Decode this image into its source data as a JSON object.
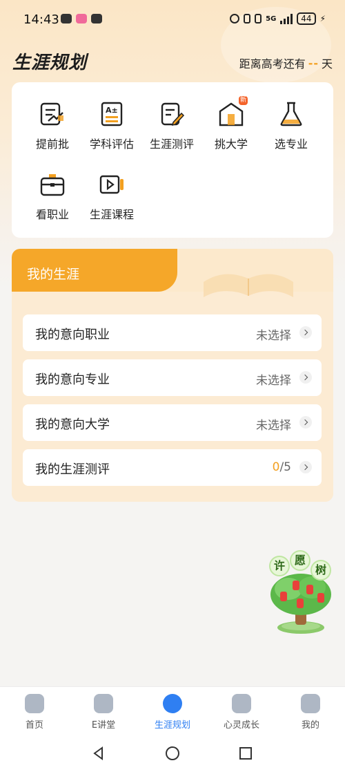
{
  "status_bar": {
    "time": "14:43",
    "battery": "44",
    "network": "5G"
  },
  "header": {
    "title": "生涯规划",
    "countdown_prefix": "距离高考还有",
    "countdown_value": "--",
    "countdown_suffix": "天"
  },
  "grid": [
    {
      "label": "提前批",
      "icon": "advance-batch-icon"
    },
    {
      "label": "学科评估",
      "icon": "subject-eval-icon"
    },
    {
      "label": "生涯测评",
      "icon": "career-test-icon"
    },
    {
      "label": "挑大学",
      "icon": "university-icon",
      "badge": "新"
    },
    {
      "label": "选专业",
      "icon": "flask-icon"
    },
    {
      "label": "看职业",
      "icon": "briefcase-icon"
    },
    {
      "label": "生涯课程",
      "icon": "video-course-icon"
    }
  ],
  "career": {
    "title": "我的生涯",
    "rows": [
      {
        "label": "我的意向职业",
        "value": "未选择"
      },
      {
        "label": "我的意向专业",
        "value": "未选择"
      },
      {
        "label": "我的意向大学",
        "value": "未选择"
      },
      {
        "label": "我的生涯测评",
        "value_done": "0",
        "value_total": "/5"
      }
    ]
  },
  "wish_tree": {
    "chars": [
      "许",
      "愿",
      "树"
    ]
  },
  "bottom_nav": [
    {
      "label": "首页",
      "active": false
    },
    {
      "label": "E讲堂",
      "active": false
    },
    {
      "label": "生涯规划",
      "active": true
    },
    {
      "label": "心灵成长",
      "active": false
    },
    {
      "label": "我的",
      "active": false
    }
  ],
  "colors": {
    "accent": "#f3a020",
    "tab_orange": "#f5a729",
    "nav_active": "#2f7ff2"
  }
}
